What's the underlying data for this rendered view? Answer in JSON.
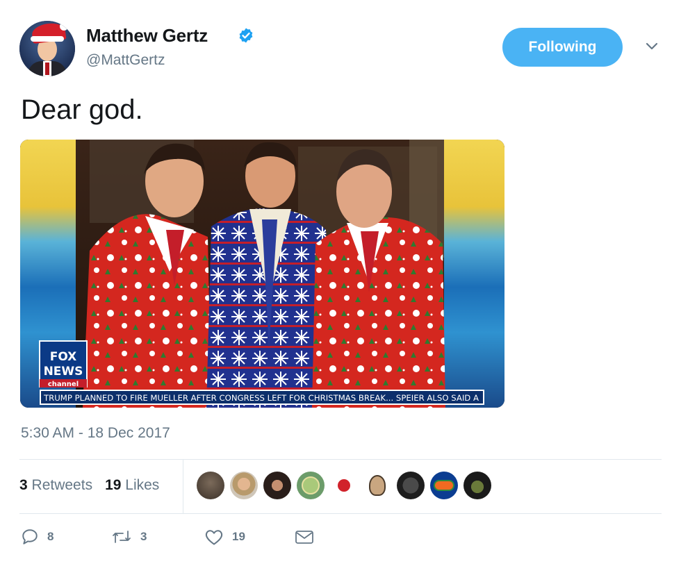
{
  "author": {
    "name": "Matthew Gertz",
    "handle": "@MattGertz",
    "follow_label": "Following",
    "avatar_icon": "santa-hat-avatar"
  },
  "tweet": {
    "text": "Dear god.",
    "timestamp": "5:30 AM - 18 Dec 2017"
  },
  "media": {
    "network_logo_line1": "FOX",
    "network_logo_line2": "NEWS",
    "network_logo_line3": "channel",
    "ticker": "TRUMP PLANNED TO FIRE MUELLER AFTER CONGRESS LEFT FOR CHRISTMAS BREAK... SPEIER ALSO SAID A"
  },
  "stats": {
    "retweets_count": "3",
    "retweets_label": "Retweets",
    "likes_count": "19",
    "likes_label": "Likes"
  },
  "actions": {
    "reply_count": "8",
    "retweet_count": "3",
    "like_count": "19"
  },
  "colors": {
    "accent": "#4ab3f4",
    "muted": "#657786",
    "verified": "#1da1f2"
  }
}
